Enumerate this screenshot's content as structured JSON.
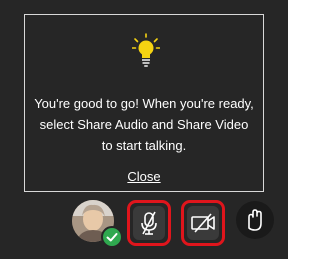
{
  "tip": {
    "message": "You're good to go! When you're ready, select Share Audio and Share Video to start talking.",
    "close_label": "Close",
    "icon": "lightbulb-icon"
  },
  "controls": {
    "avatar_icon": "user-avatar",
    "status_icon": "check-icon",
    "audio_icon": "microphone-muted-icon",
    "video_icon": "camera-off-icon",
    "hand_icon": "raise-hand-icon"
  },
  "colors": {
    "background": "#262626",
    "highlight": "#e0151c",
    "bulb": "#f5d312",
    "status_ok": "#2fa84f"
  }
}
